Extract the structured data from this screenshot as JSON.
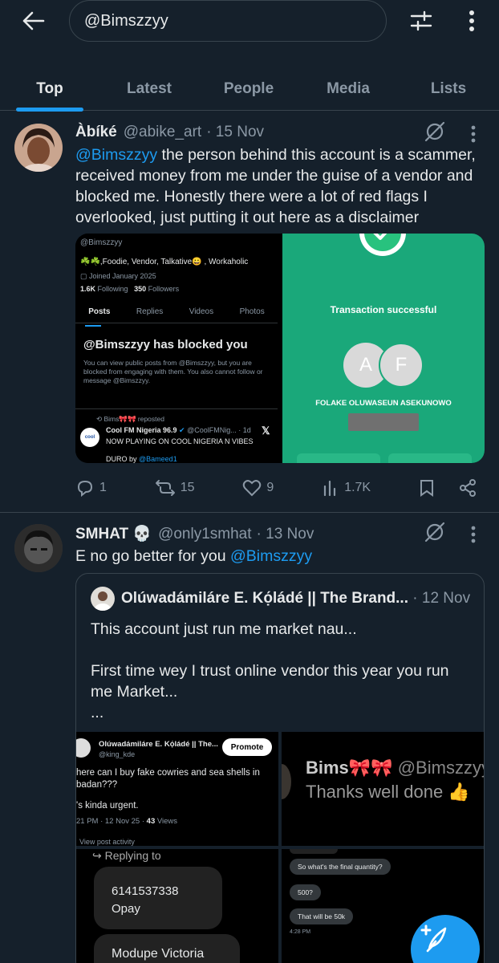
{
  "search": {
    "query": "@Bimszzyy"
  },
  "tabs": [
    {
      "label": "Top"
    },
    {
      "label": "Latest"
    },
    {
      "label": "People"
    },
    {
      "label": "Media"
    },
    {
      "label": "Lists"
    }
  ],
  "tweet1": {
    "name": "Àbíké",
    "handle": "@abike_art",
    "date": "· 15 Nov",
    "mention": "@Bimszzyy",
    "text": " the person behind this account is a scammer, received money from me under the guise of a vendor and blocked me. Honestly there were a lot of red flags I overlooked, just putting it out here as a disclaimer",
    "media_left": {
      "handle": "@Bimszzyy",
      "bio": "☘️☘️,Foodie, Vendor, Talkative😀 , Workaholic",
      "joined": "Joined January 2025",
      "following_count": "1.6K",
      "following_label": "Following",
      "followers_count": "350",
      "followers_label": "Followers",
      "tabs": [
        "Posts",
        "Replies",
        "Videos",
        "Photos"
      ],
      "blocked_title": "@Bimszzyy has blocked you",
      "blocked_body": "You can view public posts from @Bimszzyy, but you are blocked from engaging with them. You also cannot follow or message @Bimszzyy.",
      "repost_line": "Bims🎀🎀 reposted",
      "repost_name": "Cool FM Nigeria 96.9",
      "repost_handle": "@CoolFMNig... · 1d",
      "repost_text": "NOW PLAYING ON COOL NIGERIA N VIBES",
      "repost_text2": "DURO by",
      "repost_mention": "@Bameed1",
      "logo": "cool"
    },
    "media_right": {
      "status": "Transaction successful",
      "initial1": "A",
      "initial2": "F",
      "recipient": "FOLAKE OLUWASEUN ASEKUNOWO"
    },
    "replies": "1",
    "reposts": "15",
    "likes": "9",
    "views": "1.7K"
  },
  "tweet2": {
    "name": "SMHAT 💀",
    "handle": "@only1smhat",
    "date": "· 13 Nov",
    "text": "E no go better for you ",
    "mention": "@Bimszzyy",
    "quote": {
      "name": "Olúwadámiláre E. Kọ́ládé || The Brand...",
      "date": "· 12 Nov",
      "line1": "This account just run me market nau...",
      "line2": "First time wey I trust online vendor this year you run me Market...",
      "line3": "...",
      "img1": {
        "name": "Olúwadámiláre E. Kọ́ládé || The...",
        "handle": "@king_kde",
        "promote": "Promote",
        "text": "here can I buy fake cowries and sea shells in badan???",
        "text2": "'s kinda urgent.",
        "meta": "21 PM · 12 Nov 25 · ",
        "views_count": "43",
        "views_label": "Views",
        "activity": "View post activity"
      },
      "img2": {
        "name": "Bims🎀🎀",
        "handle": "@Bimszzyy",
        "text": "Thanks well done 👍"
      },
      "img3": {
        "reply_label": "Replying to",
        "account": "6141537338",
        "bank": "Opay",
        "holder": "Modupe Victoria"
      },
      "img4": {
        "msg1": "So what's the final quantity?",
        "msg2": "500?",
        "msg3": "That will be 50k",
        "time": "4:28 PM"
      }
    }
  },
  "colors": {
    "background": "#15202b",
    "accent": "#1d9bf0",
    "muted": "#8b98a5",
    "divider": "#38444d",
    "green": "#1aa87a"
  }
}
